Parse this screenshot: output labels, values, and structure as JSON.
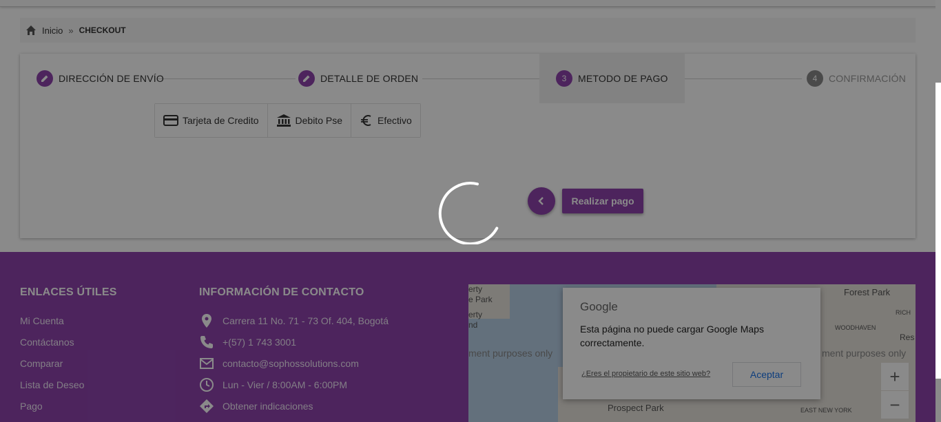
{
  "breadcrumb": {
    "home": "Inicio",
    "separator": "»",
    "current": "CHECKOUT"
  },
  "steps": [
    {
      "label": "DIRECCIÓN DE ENVÍO",
      "badge": "",
      "icon": "pencil-icon"
    },
    {
      "label": "DETALLE DE ORDEN",
      "badge": "",
      "icon": "pencil-icon"
    },
    {
      "label": "METODO DE PAGO",
      "badge": "3"
    },
    {
      "label": "CONFIRMACIÓN",
      "badge": "4"
    }
  ],
  "payment_tabs": [
    {
      "label": "Tarjeta de Credito",
      "icon": "credit-card-icon"
    },
    {
      "label": "Debito Pse",
      "icon": "bank-icon"
    },
    {
      "label": "Efectivo",
      "icon": "euro-icon"
    }
  ],
  "actions": {
    "pay_label": "Realizar pago"
  },
  "footer": {
    "links_title": "ENLACES ÚTILES",
    "links": [
      "Mi Cuenta",
      "Contáctanos",
      "Comparar",
      "Lista de Deseo",
      "Pago"
    ],
    "contact_title": "INFORMACIÓN DE CONTACTO",
    "contact": [
      {
        "text": "Carrera 11 No. 71 - 73 Of. 404, Bogotá",
        "icon": "location-pin-icon"
      },
      {
        "text": "+(57) 1 743 3001",
        "icon": "phone-icon"
      },
      {
        "text": "contacto@sophossolutions.com",
        "icon": "mail-icon"
      },
      {
        "text": "Lun - Vier / 8:00AM - 6:00PM",
        "icon": "clock-icon"
      },
      {
        "text": "Obtener indicaciones",
        "icon": "directions-icon"
      }
    ]
  },
  "map": {
    "dialog_brand": "Google",
    "dialog_message": "Esta página no puede cargar Google Maps correctamente.",
    "owner_link": "¿Eres el propietario de este sitio web?",
    "accept_label": "Aceptar",
    "watermark": "ment purposes only",
    "labels": [
      "Forest Park",
      "Prospect Park",
      "WOODHAVEN",
      "EAST NEW YORK",
      "RICH",
      "Res",
      "erty",
      "e Park",
      "erty",
      "nd"
    ],
    "zoom_in": "+",
    "zoom_out": "−"
  },
  "colors": {
    "primary": "#8e44ad",
    "overlay": "rgba(0,0,0,0.46)"
  }
}
